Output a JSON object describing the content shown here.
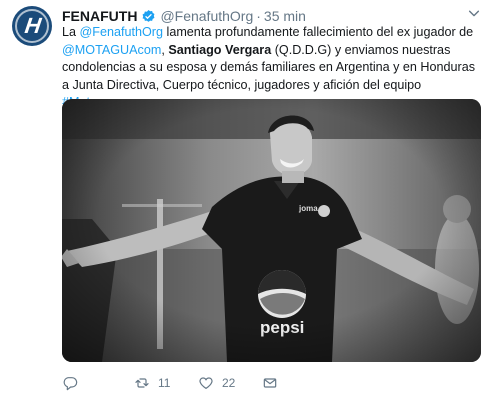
{
  "tweet": {
    "name": "FENAFUTH",
    "handle": "@FenafuthOrg",
    "separator": "·",
    "time": "35 min",
    "text": {
      "p1": "La ",
      "mention1": "@FenafuthOrg",
      "p2": "  lamenta profundamente fallecimiento del ex jugador de ",
      "mention2": "@MOTAGUAcom",
      "p3": ", ",
      "bold_name": "Santiago Vergara",
      "p4": " (Q.D.D.G) y enviamos nuestras condolencias a su esposa y demás familiares en Argentina y en Honduras a Junta Directiva, Cuerpo técnico, jugadores y afición del equipo ",
      "hashtag": "#Motagua",
      "p5": "."
    },
    "media": {
      "jersey_brand": "joma",
      "sponsor": "pepsi"
    },
    "actions": {
      "retweets": "11",
      "likes": "22"
    },
    "colors": {
      "link": "#1da1f2",
      "verified": "#1da1f2",
      "muted": "#657786"
    }
  }
}
